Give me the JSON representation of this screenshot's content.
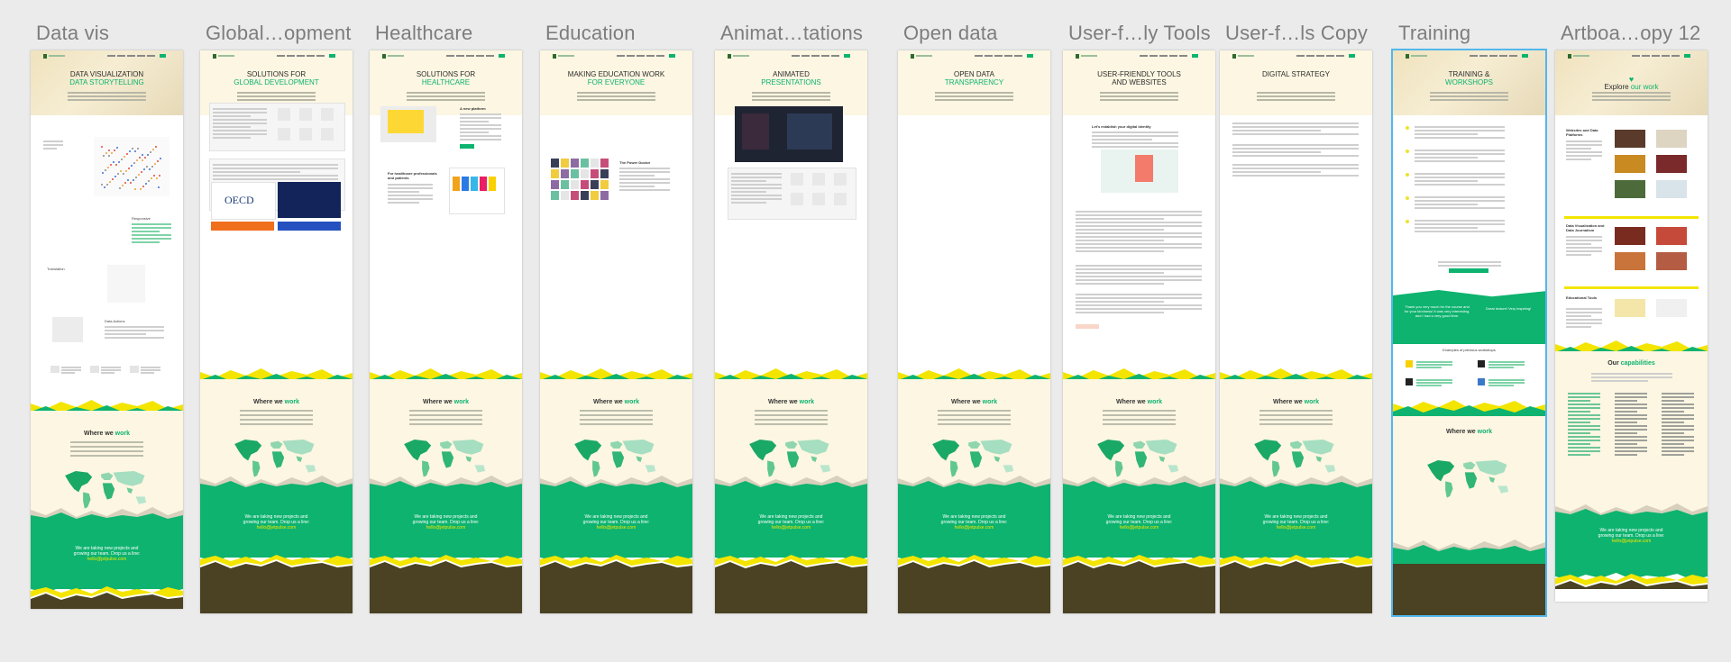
{
  "canvas": {
    "background": "#ebebeb"
  },
  "colors": {
    "accent": "#0db36f",
    "yellow": "#f3e500",
    "cream": "#fcf6e2",
    "brown": "#4a4223",
    "selection": "#52b7ec"
  },
  "boards": [
    {
      "title": "Data vis",
      "hero_line1": "DATA VISUALIZATION",
      "hero_line2": "DATA STORYTELLING",
      "section_texts": [
        "Responsive",
        "Translation",
        "Data Actions"
      ]
    },
    {
      "title": "Global…opment",
      "hero_line1": "SOLUTIONS FOR",
      "hero_line2": "GLOBAL DEVELOPMENT",
      "logo_text": "OECD"
    },
    {
      "title": "Healthcare",
      "hero_line1": "SOLUTIONS FOR",
      "hero_line2": "HEALTHCARE",
      "section_texts": [
        "A new platform",
        "For healthcare professionals and patients"
      ]
    },
    {
      "title": "Education",
      "hero_line1": "MAKING EDUCATION WORK",
      "hero_line2": "FOR EVERYONE",
      "section_texts": [
        "The Power Doctor"
      ]
    },
    {
      "title": "Animat…tations",
      "hero_line1": "ANIMATED",
      "hero_line2": "PRESENTATIONS"
    },
    {
      "title": "Open data",
      "hero_line1": "OPEN DATA",
      "hero_line2": "TRANSPARENCY"
    },
    {
      "title": "User-f…ly Tools",
      "hero_line1": "USER-FRIENDLY TOOLS",
      "hero_line2": "AND WEBSITES",
      "section_texts": [
        "Let's establish your digital identity"
      ]
    },
    {
      "title": "User-f…ls Copy",
      "hero_line1": "DIGITAL STRATEGY",
      "hero_line2": ""
    },
    {
      "title": "Training",
      "hero_line1": "TRAINING &",
      "hero_line2": "WORKSHOPS",
      "section_texts": [
        "Thank you very much for the course and for your kindness! It was very interesting, and I had a very good time.",
        "Great lecture! Very inspiring!",
        "Examples of previous workshops"
      ]
    },
    {
      "title": "Artboa…opy 12",
      "hero_line1": "Explore",
      "hero_line2": "our work",
      "section_texts": [
        "Our",
        "capabilities",
        "Websites and Data Platforms",
        "Data Visualization and Data Journalism",
        "Educational Tools"
      ]
    }
  ],
  "shared": {
    "where_title": "Where we",
    "where_accent": "work",
    "contact_line1": "We are taking new projects and",
    "contact_line2": "growing our team. Drop us a line:",
    "contact_email": "hello@jetpulse.com"
  }
}
